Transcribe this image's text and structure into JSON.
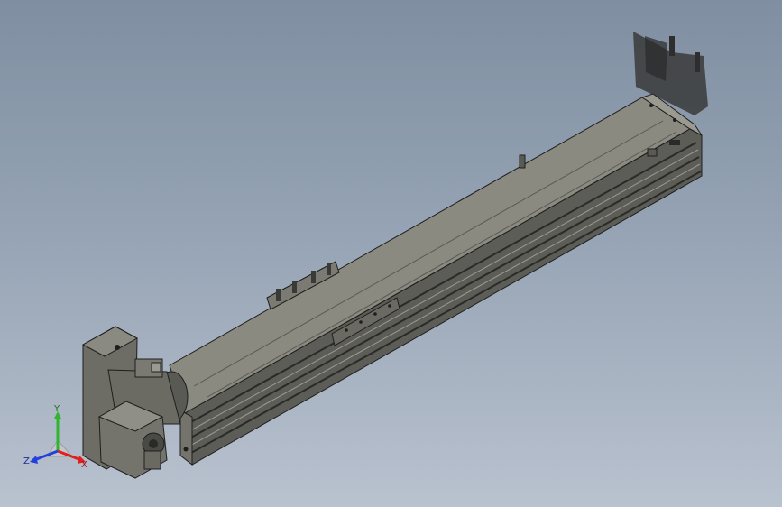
{
  "viewport": {
    "background_top": "#7f8fa1",
    "background_bottom": "#b9c2cf"
  },
  "model": {
    "body_color": "#6f6f66",
    "top_face_color": "#8a8a80",
    "edge_color": "#1e1e1e",
    "rail_color": "#4a4a46"
  },
  "triad": {
    "x_label": "X",
    "y_label": "Y",
    "z_label": "Z",
    "x_color": "#e02020",
    "y_color": "#2fb52f",
    "z_color": "#2440d8"
  }
}
